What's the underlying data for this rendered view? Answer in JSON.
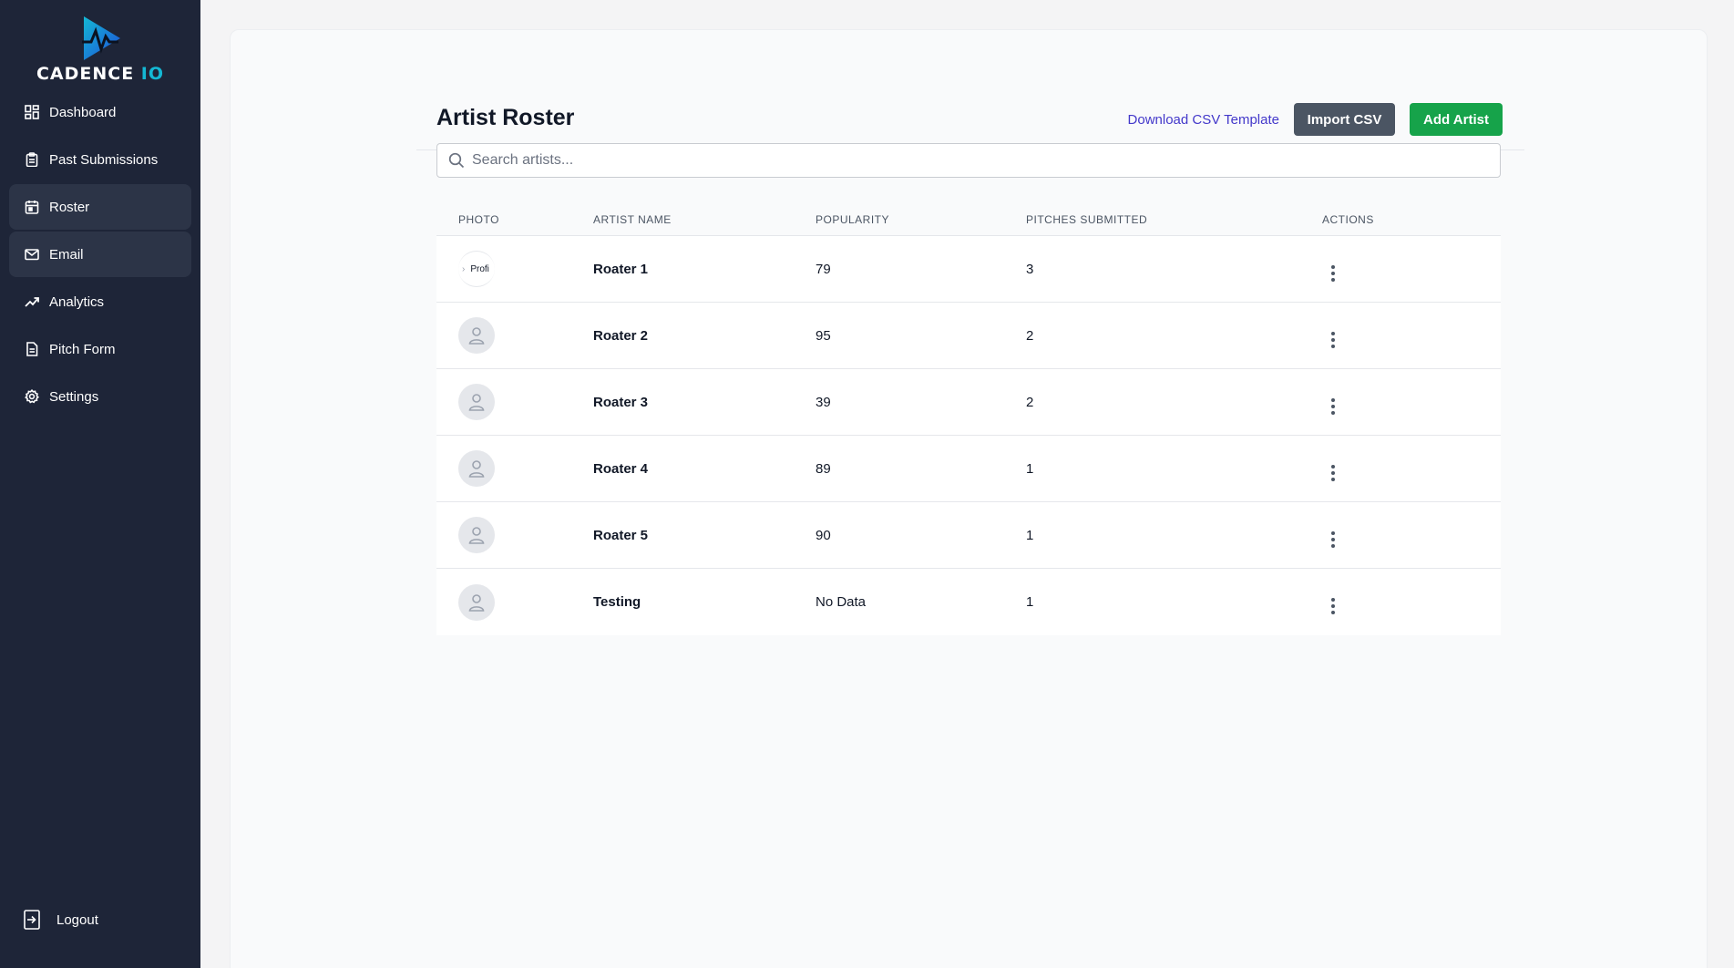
{
  "brand": {
    "name_main": "CADENCE ",
    "name_accent": "IO"
  },
  "nav": {
    "items": [
      {
        "label": "Dashboard",
        "icon": "dashboard-icon"
      },
      {
        "label": "Past Submissions",
        "icon": "clipboard-icon"
      },
      {
        "label": "Roster",
        "icon": "calendar-icon",
        "active": true
      },
      {
        "label": "Email",
        "icon": "mail-icon",
        "active": true
      },
      {
        "label": "Analytics",
        "icon": "trending-up-icon"
      },
      {
        "label": "Pitch Form",
        "icon": "document-icon"
      },
      {
        "label": "Settings",
        "icon": "gear-icon"
      }
    ],
    "logout": "Logout"
  },
  "page": {
    "title": "Artist Roster",
    "download_label": "Download CSV Template",
    "import_label": "Import CSV",
    "add_label": "Add Artist",
    "search_placeholder": "Search artists..."
  },
  "table": {
    "headers": [
      "PHOTO",
      "ARTIST NAME",
      "POPULARITY",
      "PITCHES SUBMITTED",
      "ACTIONS"
    ],
    "rows": [
      {
        "photo": "Profi",
        "name": "Roater 1",
        "popularity": "79",
        "pitches": "3"
      },
      {
        "photo": "",
        "name": "Roater 2",
        "popularity": "95",
        "pitches": "2"
      },
      {
        "photo": "",
        "name": "Roater 3",
        "popularity": "39",
        "pitches": "2"
      },
      {
        "photo": "",
        "name": "Roater 4",
        "popularity": "89",
        "pitches": "1"
      },
      {
        "photo": "",
        "name": "Roater 5",
        "popularity": "90",
        "pitches": "1"
      },
      {
        "photo": "",
        "name": "Testing",
        "popularity": "No Data",
        "pitches": "1"
      }
    ]
  },
  "colors": {
    "sidebar": "#1e2538",
    "accent": "#14b8d4",
    "add_button": "#16a34a",
    "import_button": "#4b5563",
    "link": "#4338ca"
  }
}
